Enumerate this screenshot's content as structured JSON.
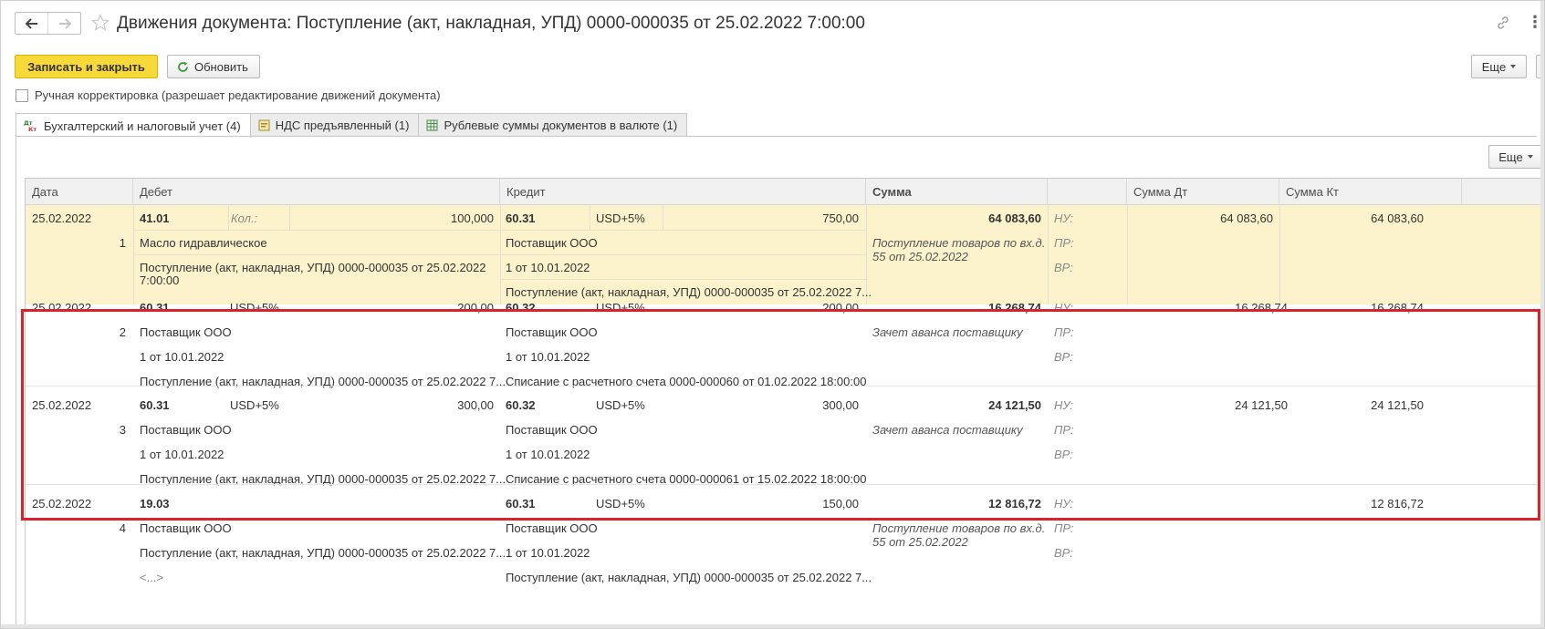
{
  "header": {
    "title": "Движения документа: Поступление (акт, накладная, УПД) 0000-000035 от 25.02.2022 7:00:00"
  },
  "toolbar": {
    "save_close": "Записать и закрыть",
    "refresh": "Обновить",
    "more": "Еще"
  },
  "manual_edit_label": "Ручная корректировка (разрешает редактирование движений документа)",
  "tabs": [
    {
      "label": "Бухгалтерский и налоговый учет (4)",
      "icon": "dt-kt-icon"
    },
    {
      "label": "НДС предъявленный (1)",
      "icon": "register-icon"
    },
    {
      "label": "Рублевые суммы документов в валюте (1)",
      "icon": "table-icon"
    }
  ],
  "panel": {
    "more": "Еще"
  },
  "columns": [
    "Дата",
    "Дебет",
    "Кредит",
    "Сумма",
    "",
    "Сумма Дт",
    "Сумма Кт"
  ],
  "rows": [
    {
      "date": "25.02.2022",
      "num": "1",
      "debit_account": "41.01",
      "debit_sub_label": "Кол.:",
      "debit_amount": "100,000",
      "debit_lines": [
        "Масло гидравлическое",
        "Поступление (акт, накладная, УПД) 0000-000035 от 25.02.2022",
        "7:00:00"
      ],
      "credit_account": "60.31",
      "credit_currency": "USD+5%",
      "credit_amount": "750,00",
      "credit_lines": [
        "Поставщик ООО",
        "1 от 10.01.2022",
        "Поступление (акт, накладная, УПД) 0000-000035 от 25.02.2022 7..."
      ],
      "sum": "64 083,60",
      "content": [
        "Поступление товаров по вх.д.",
        "55 от 25.02.2022"
      ],
      "nu": "НУ:",
      "pr": "ПР:",
      "vr": "ВР:",
      "sum_dt": "64 083,60",
      "sum_kt": "64 083,60"
    },
    {
      "date": "25.02.2022",
      "num": "2",
      "debit_account": "60.31",
      "debit_currency": "USD+5%",
      "debit_amount": "200,00",
      "debit_lines": [
        "Поставщик ООО",
        "1 от 10.01.2022",
        "Поступление (акт, накладная, УПД) 0000-000035 от 25.02.2022 7..."
      ],
      "credit_account": "60.32",
      "credit_currency": "USD+5%",
      "credit_amount": "200,00",
      "credit_lines": [
        "Поставщик ООО",
        "1 от 10.01.2022",
        "Списание с расчетного счета 0000-000060 от 01.02.2022 18:00:00"
      ],
      "sum": "16 268,74",
      "content": [
        "Зачет аванса поставщику"
      ],
      "nu": "НУ:",
      "pr": "ПР:",
      "vr": "ВР:",
      "sum_dt": "16 268,74",
      "sum_kt": "16 268,74"
    },
    {
      "date": "25.02.2022",
      "num": "3",
      "debit_account": "60.31",
      "debit_currency": "USD+5%",
      "debit_amount": "300,00",
      "debit_lines": [
        "Поставщик ООО",
        "1 от 10.01.2022",
        "Поступление (акт, накладная, УПД) 0000-000035 от 25.02.2022 7..."
      ],
      "credit_account": "60.32",
      "credit_currency": "USD+5%",
      "credit_amount": "300,00",
      "credit_lines": [
        "Поставщик ООО",
        "1 от 10.01.2022",
        "Списание с расчетного счета 0000-000061 от 15.02.2022 18:00:00"
      ],
      "sum": "24 121,50",
      "content": [
        "Зачет аванса поставщику"
      ],
      "nu": "НУ:",
      "pr": "ПР:",
      "vr": "ВР:",
      "sum_dt": "24 121,50",
      "sum_kt": "24 121,50"
    },
    {
      "date": "25.02.2022",
      "num": "4",
      "debit_account": "19.03",
      "debit_lines": [
        "Поставщик ООО",
        "Поступление (акт, накладная, УПД) 0000-000035 от 25.02.2022 7...",
        "<...>"
      ],
      "credit_account": "60.31",
      "credit_currency": "USD+5%",
      "credit_amount": "150,00",
      "credit_lines": [
        "Поставщик ООО",
        "1 от 10.01.2022",
        "Поступление (акт, накладная, УПД) 0000-000035 от 25.02.2022 7..."
      ],
      "sum": "12 816,72",
      "content": [
        "Поступление товаров по вх.д.",
        "55 от 25.02.2022"
      ],
      "nu": "НУ:",
      "pr": "ПР:",
      "vr": "ВР:",
      "sum_dt": "",
      "sum_kt": "12 816,72"
    }
  ]
}
